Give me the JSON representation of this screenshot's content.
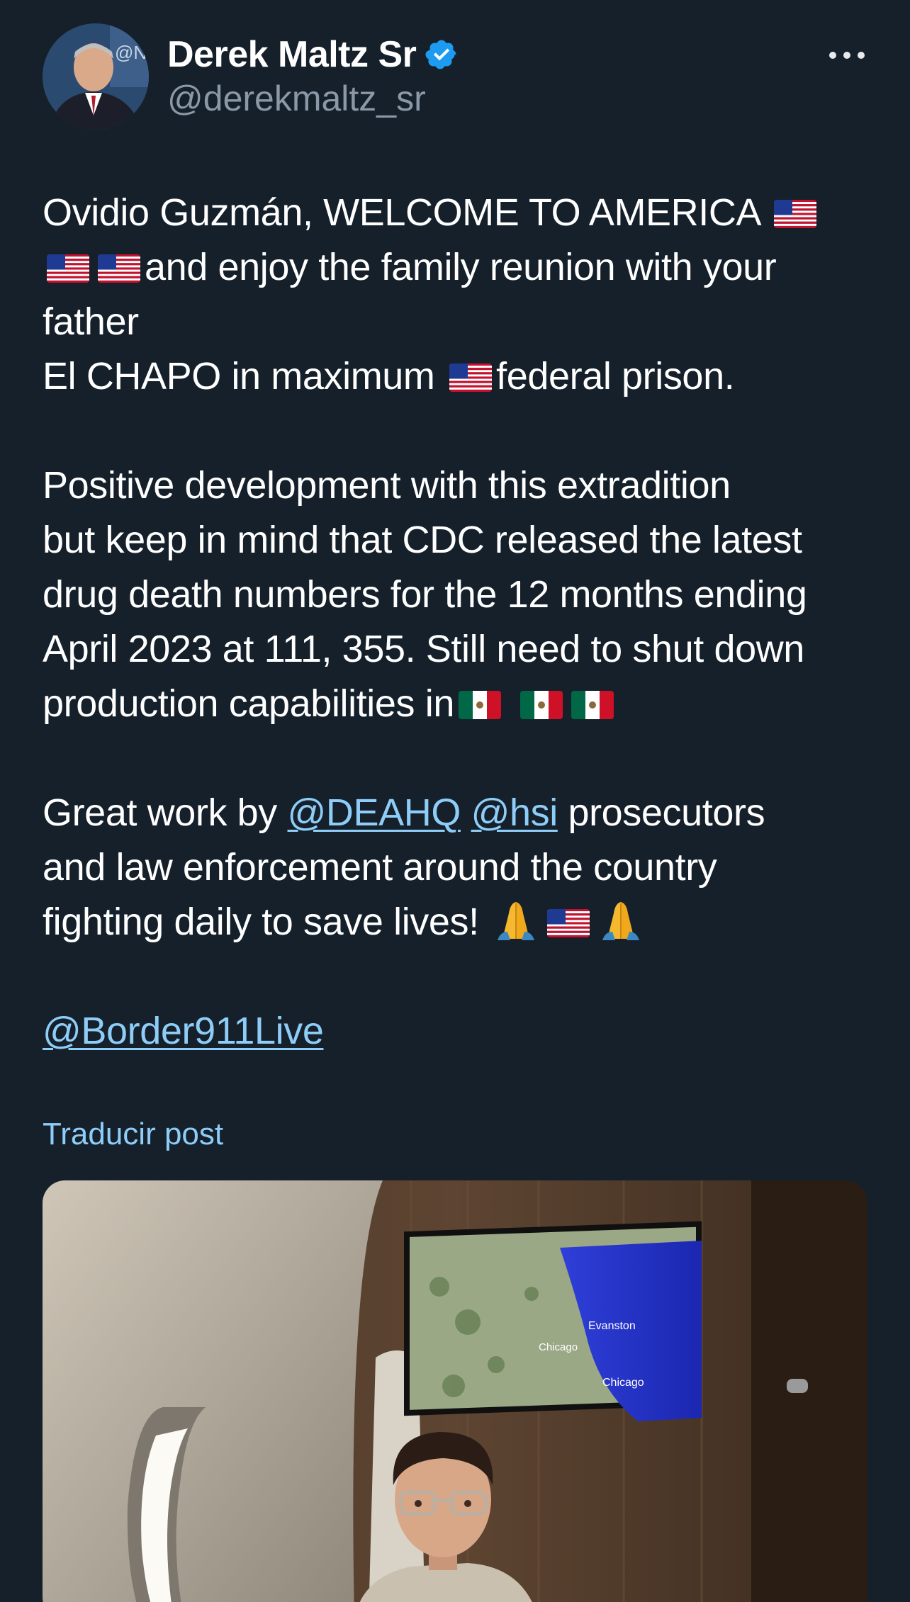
{
  "author": {
    "display_name": "Derek Maltz Sr",
    "handle": "@derekmaltz_sr",
    "verified": true,
    "avatar_icon": "profile-photo",
    "avatar_watermark": "@N"
  },
  "post": {
    "line1": "Ovidio Guzmán, WELCOME TO AMERICA",
    "line2": "and enjoy the family reunion with your",
    "line3": "father",
    "line4a": "El CHAPO in maximum",
    "line4b": "federal prison.",
    "line5": "Positive development with this extradition",
    "line6": "but keep in mind that CDC released the latest",
    "line7": "drug death numbers for the 12 months ending",
    "line8": "April 2023 at 111, 355. Still need to shut down",
    "line9": "production capabilities in",
    "line10a": "Great work by",
    "mention_dea": "@DEAHQ",
    "mention_hsi": "@hsi",
    "line10b": "prosecutors",
    "line11": "and law enforcement around the country",
    "line12": "fighting daily to save lives!",
    "mention_border": "@Border911Live"
  },
  "emojis": {
    "us_flag": "us-flag-emoji",
    "mx_flag": "mexico-flag-emoji",
    "pray": "folded-hands-emoji"
  },
  "translate_label": "Traducir post",
  "media": {
    "map_labels": [
      "Evanston",
      "Chicago",
      "Chicago"
    ]
  },
  "colors": {
    "background": "#15202b",
    "text": "#ffffff",
    "secondary": "#8b98a5",
    "link": "#8ecdf8",
    "verified": "#1d9bf0"
  }
}
